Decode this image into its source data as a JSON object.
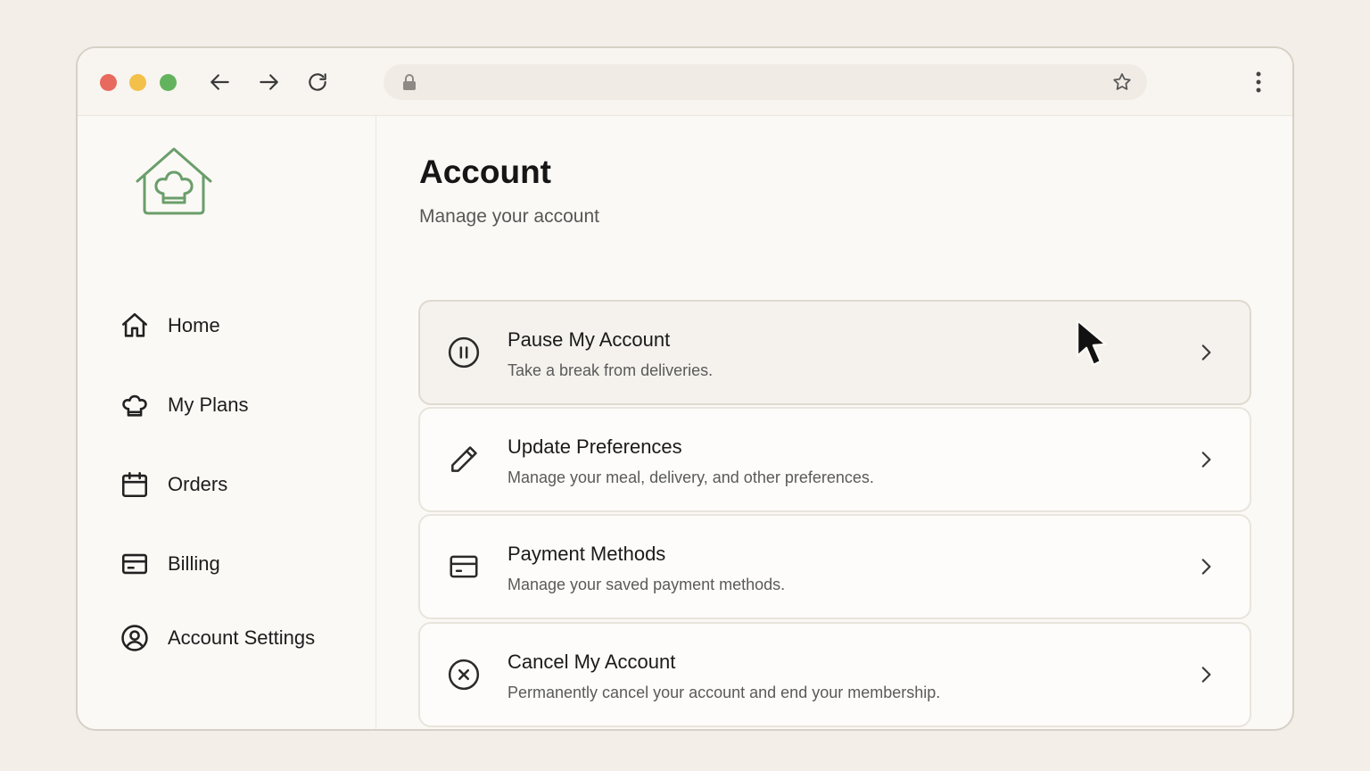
{
  "browser": {
    "url": "",
    "colors": {
      "close": "#e8695e",
      "minimize": "#f3c04a",
      "maximize": "#63b35e"
    }
  },
  "sidebar": {
    "logo_icon": "house-chef-hat-icon",
    "brand_color": "#6a9e6b",
    "items": [
      {
        "label": "Home",
        "icon": "home-icon"
      },
      {
        "label": "My Plans",
        "icon": "chef-hat-icon"
      },
      {
        "label": "Orders",
        "icon": "calendar-icon"
      },
      {
        "label": "Billing",
        "icon": "credit-card-icon"
      },
      {
        "label": "Account Settings",
        "icon": "user-circle-icon"
      }
    ]
  },
  "main": {
    "title": "Account",
    "subtitle": "Manage your account",
    "cards": [
      {
        "title": "Pause My Account",
        "description": "Take a break from deliveries.",
        "icon": "pause-icon",
        "hovered": true
      },
      {
        "title": "Update Preferences",
        "description": "Manage your meal, delivery, and other preferences.",
        "icon": "pencil-icon"
      },
      {
        "title": "Payment Methods",
        "description": "Manage your saved payment methods.",
        "icon": "credit-card-icon"
      },
      {
        "title": "Cancel My Account",
        "description": "Permanently cancel your account and end your membership.",
        "icon": "x-circle-icon"
      }
    ]
  }
}
